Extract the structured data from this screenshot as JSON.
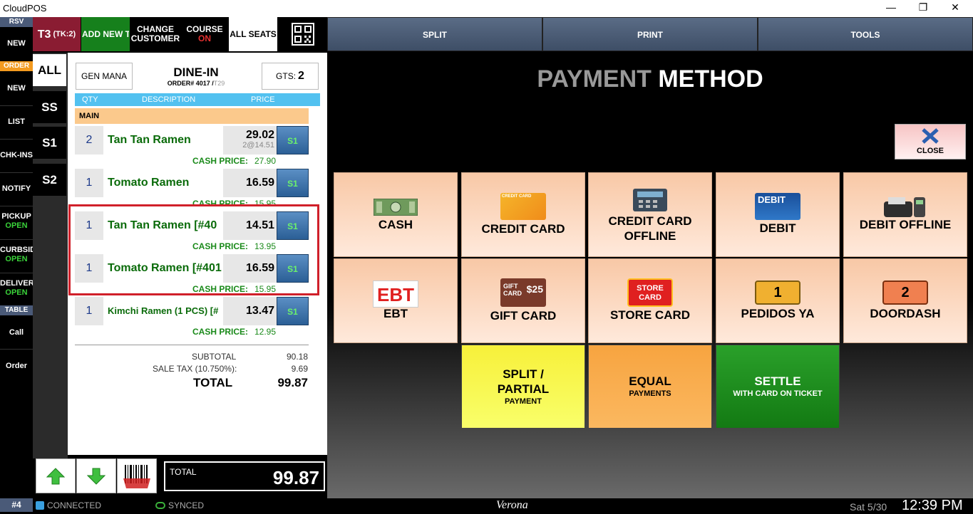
{
  "window": {
    "title": "CloudPOS",
    "minimize": "—",
    "maximize": "❐",
    "close": "✕"
  },
  "leftnav": {
    "rsv_header": "RSV",
    "rsv_new": "NEW",
    "order_header": "ORDER",
    "order_new": "NEW",
    "list": "LIST",
    "chkins": "CHK-INS",
    "notify": "NOTIFY",
    "pickup": "PICKUP",
    "pickup_status": "OPEN",
    "curbside": "CURBSID",
    "curbside_status": "OPEN",
    "delivery": "DELIVER",
    "delivery_status": "OPEN",
    "table_header": "TABLE",
    "call": "Call",
    "order": "Order"
  },
  "topbar": {
    "table": "T3",
    "ticket": "(TK:2)",
    "add_new": "ADD NEW T",
    "change_customer_1": "CHANGE",
    "change_customer_2": "CUSTOMER",
    "course_1": "COURSE",
    "course_2": "ON",
    "all_seats": "ALL SEATS",
    "qr_icon": "qr-code-icon"
  },
  "tabs": {
    "split": "SPLIT",
    "print": "PRINT",
    "tools": "TOOLS"
  },
  "seats": [
    "ALL",
    "SS",
    "S1",
    "S2"
  ],
  "order": {
    "server": "GEN MANA",
    "type": "DINE-IN",
    "order_prefix": "ORDER# 4017 /",
    "order_table": "T29",
    "guests_label": "GTS:",
    "guests": "2",
    "col_qty": "QTY",
    "col_desc": "DESCRIPTION",
    "col_price": "PRICE",
    "section": "MAIN",
    "items": [
      {
        "qty": "2",
        "desc": "Tan Tan Ramen",
        "price": "29.02",
        "sub": "2@14.51",
        "seat": "S1",
        "cash_label": "CASH PRICE:",
        "cash": "27.90"
      },
      {
        "qty": "1",
        "desc": "Tomato Ramen",
        "price": "16.59",
        "sub": "",
        "seat": "S1",
        "cash_label": "CASH PRICE:",
        "cash": "15.95"
      },
      {
        "qty": "1",
        "desc": "Tan Tan Ramen [#40",
        "price": "14.51",
        "sub": "",
        "seat": "S1",
        "cash_label": "CASH PRICE:",
        "cash": "13.95"
      },
      {
        "qty": "1",
        "desc": "Tomato Ramen [#401",
        "price": "16.59",
        "sub": "",
        "seat": "S1",
        "cash_label": "CASH PRICE:",
        "cash": "15.95"
      },
      {
        "qty": "1",
        "desc": "Kimchi Ramen (1 PCS) [#",
        "price": "13.47",
        "sub": "",
        "seat": "S1",
        "cash_label": "CASH PRICE:",
        "cash": "12.95"
      }
    ],
    "subtotal_label": "SUBTOTAL",
    "subtotal": "90.18",
    "tax_label": "SALE TAX (10.750%):",
    "tax": "9.69",
    "total_label": "TOTAL",
    "total": "99.87"
  },
  "bottom": {
    "total_label": "TOTAL",
    "total": "99.87"
  },
  "payment": {
    "title_a": "PAYMENT",
    "title_b": "METHOD",
    "close": "CLOSE",
    "methods": {
      "cash": "CASH",
      "credit": "CREDIT CARD",
      "credit_offline_1": "CREDIT CARD",
      "credit_offline_2": "OFFLINE",
      "debit": "DEBIT",
      "debit_offline": "DEBIT OFFLINE",
      "ebt": "EBT",
      "gift": "GIFT CARD",
      "store": "STORE CARD",
      "pedidos": "PEDIDOS YA",
      "doordash": "DOORDASH"
    },
    "icon_text": {
      "credit_card": "CREDIT CARD",
      "debit": "DEBIT",
      "ebt": "EBT",
      "gift_1": "GIFT",
      "gift_2": "CARD",
      "gift_amt": "$25",
      "store_1": "STORE",
      "store_2": "CARD",
      "pedidos_num": "1",
      "doordash_num": "2"
    },
    "split_1": "SPLIT /",
    "split_2": "PARTIAL",
    "split_3": "PAYMENT",
    "equal_1": "EQUAL",
    "equal_2": "PAYMENTS",
    "settle_1": "SETTLE",
    "settle_2": "WITH CARD ON TICKET"
  },
  "status": {
    "station": "#4",
    "connected": "CONNECTED",
    "synced": "SYNCED",
    "location": "Verona",
    "date": "Sat 5/30",
    "time": "12:39 PM"
  }
}
